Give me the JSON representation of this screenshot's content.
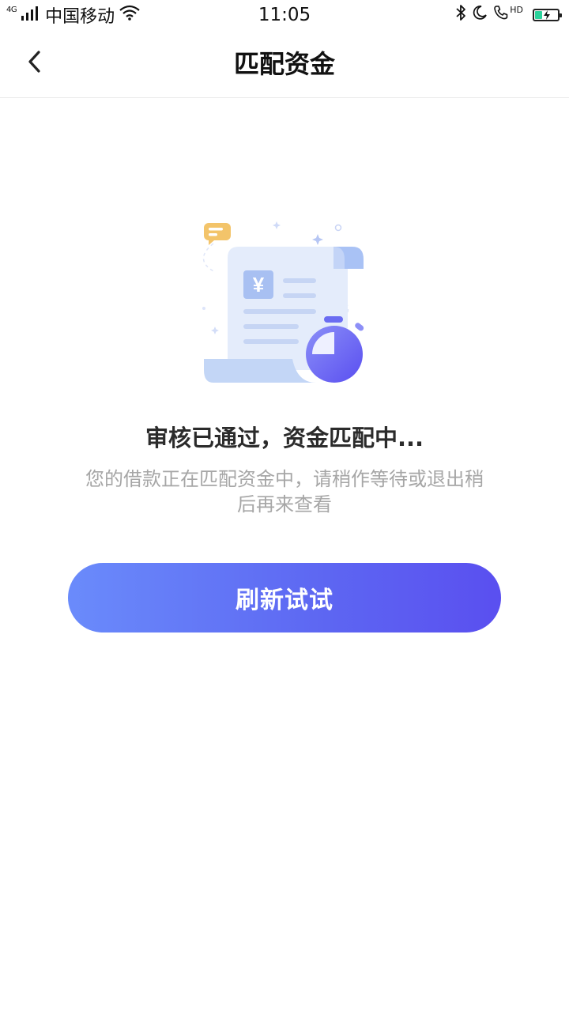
{
  "status_bar": {
    "network": "4G",
    "carrier": "中国移动",
    "time": "11:05",
    "hd": "HD",
    "battery_level": 0.35,
    "battery_color": "#2ad29b"
  },
  "nav": {
    "title": "匹配资金",
    "back_icon": "chevron-left-icon"
  },
  "main": {
    "status_title": "审核已通过，资金匹配中...",
    "status_desc": "您的借款正在匹配资金中，请稍作等待或退出稍后再来查看",
    "refresh_label": "刷新试试",
    "illustration_symbol": "¥"
  },
  "colors": {
    "accent_start": "#6a8bfb",
    "accent_end": "#5a4ff0",
    "title_text": "#2b2b2b",
    "desc_text": "#a6a6a6"
  }
}
